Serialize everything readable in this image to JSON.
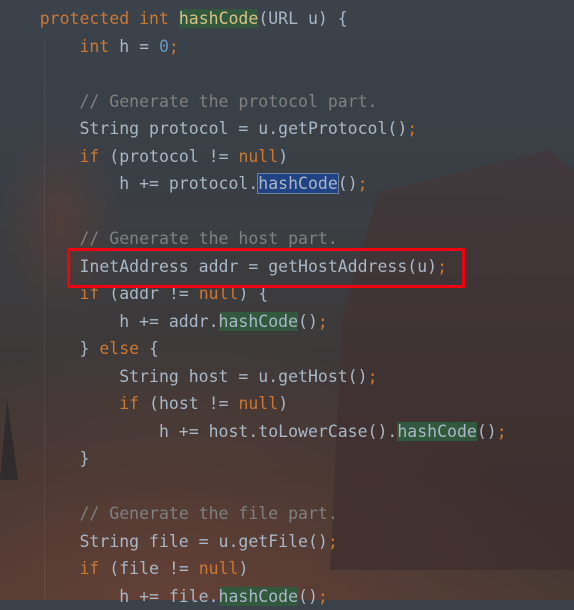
{
  "code_lines": [
    [
      {
        "t": "    "
      },
      {
        "t": "protected int ",
        "c": "kw"
      },
      {
        "t": "hashCode",
        "c": "hl"
      },
      {
        "t": "(URL u) {"
      }
    ],
    [
      {
        "t": "        "
      },
      {
        "t": "int ",
        "c": "kw"
      },
      {
        "t": "h = "
      },
      {
        "t": "0",
        "c": "num"
      },
      {
        "t": ";",
        "c": "semi"
      }
    ],
    [],
    [
      {
        "t": "        "
      },
      {
        "t": "// Generate the protocol part.",
        "c": "cmt"
      }
    ],
    [
      {
        "t": "        String protocol = u.getProtocol()"
      },
      {
        "t": ";",
        "c": "semi"
      }
    ],
    [
      {
        "t": "        "
      },
      {
        "t": "if ",
        "c": "kw"
      },
      {
        "t": "(protocol != "
      },
      {
        "t": "null",
        "c": "kw"
      },
      {
        "t": ")"
      }
    ],
    [
      {
        "t": "            h += protocol."
      },
      {
        "t": "hashCode",
        "c": "sel"
      },
      {
        "t": "()"
      },
      {
        "t": ";",
        "c": "semi"
      }
    ],
    [],
    [
      {
        "t": "        "
      },
      {
        "t": "// Generate the host part.",
        "c": "cmt"
      }
    ],
    [
      {
        "t": "        InetAddress addr = getHostAddress(u)"
      },
      {
        "t": ";",
        "c": "semi"
      }
    ],
    [
      {
        "t": "        "
      },
      {
        "t": "if ",
        "c": "kw"
      },
      {
        "t": "(addr != "
      },
      {
        "t": "null",
        "c": "kw"
      },
      {
        "t": ") {"
      }
    ],
    [
      {
        "t": "            h += addr."
      },
      {
        "t": "hashCode",
        "c": "hl2"
      },
      {
        "t": "()"
      },
      {
        "t": ";",
        "c": "semi"
      }
    ],
    [
      {
        "t": "        } "
      },
      {
        "t": "else ",
        "c": "kw"
      },
      {
        "t": "{"
      }
    ],
    [
      {
        "t": "            String host = u.getHost()"
      },
      {
        "t": ";",
        "c": "semi"
      }
    ],
    [
      {
        "t": "            "
      },
      {
        "t": "if ",
        "c": "kw"
      },
      {
        "t": "(host != "
      },
      {
        "t": "null",
        "c": "kw"
      },
      {
        "t": ")"
      }
    ],
    [
      {
        "t": "                h += host.toLowerCase()."
      },
      {
        "t": "hashCode",
        "c": "hl2"
      },
      {
        "t": "()"
      },
      {
        "t": ";",
        "c": "semi"
      }
    ],
    [
      {
        "t": "        }"
      }
    ],
    [],
    [
      {
        "t": "        "
      },
      {
        "t": "// Generate the file part.",
        "c": "cmt"
      }
    ],
    [
      {
        "t": "        String file = u.getFile()"
      },
      {
        "t": ";",
        "c": "semi"
      }
    ],
    [
      {
        "t": "        "
      },
      {
        "t": "if ",
        "c": "kw"
      },
      {
        "t": "(file != "
      },
      {
        "t": "null",
        "c": "kw"
      },
      {
        "t": ")"
      }
    ],
    [
      {
        "t": "            h += file."
      },
      {
        "t": "hashCode",
        "c": "hl2"
      },
      {
        "t": "()"
      },
      {
        "t": ";",
        "c": "semi"
      }
    ]
  ],
  "highlighted_line": 9,
  "colors": {
    "keyword": "#cc7832",
    "number": "#6897bb",
    "comment": "#808080",
    "text": "#a9b7c6",
    "annotation_box": "#f00010"
  }
}
